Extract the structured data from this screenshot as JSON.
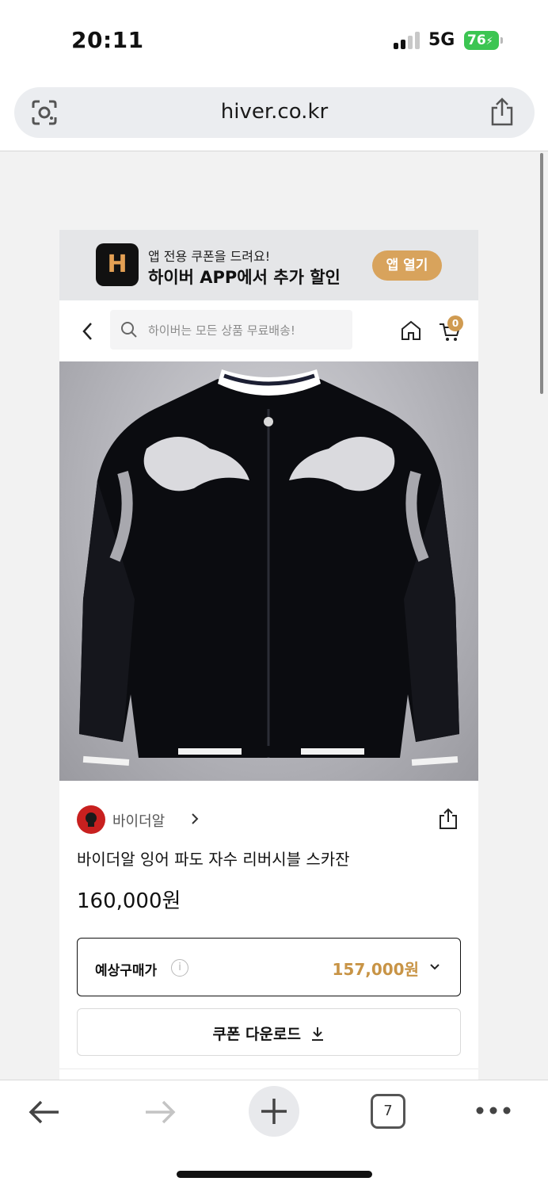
{
  "status_bar": {
    "time": "20:11",
    "network": "5G",
    "battery": "76"
  },
  "browser": {
    "url": "hiver.co.kr"
  },
  "app_banner": {
    "logo_letter": "H",
    "subtitle": "앱 전용 쿠폰을 드려요!",
    "title": "하이버 APP에서 추가 할인",
    "open_button": "앱 열기"
  },
  "shop_header": {
    "search_placeholder": "하이버는 모든 상품 무료배송!",
    "cart_count": "0"
  },
  "product": {
    "brand": "바이더알",
    "title": "바이더알 잉어 파도 자수 리버시블 스카잔",
    "price": "160,000원",
    "expected_price_label": "예상구매가",
    "expected_price": "157,000원",
    "coupon_button": "쿠폰 다운로드"
  },
  "toolbar": {
    "tab_count": "7"
  },
  "colors": {
    "accent_gold": "#c89446",
    "battery_green": "#3cc552",
    "app_open_bg": "#d8a35c"
  }
}
